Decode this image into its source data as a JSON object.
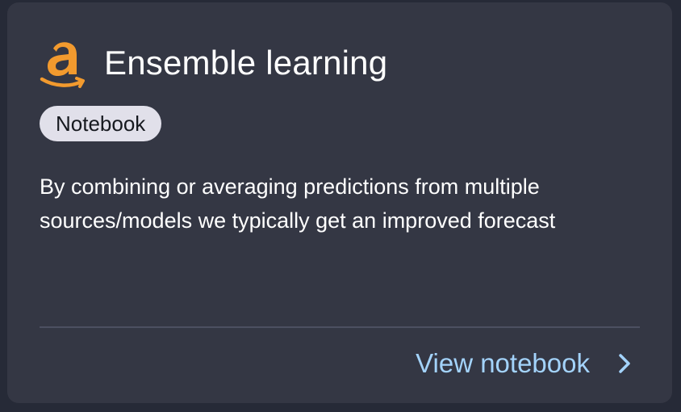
{
  "card": {
    "logo_icon": "amazon-logo-icon",
    "title": "Ensemble learning",
    "badge": "Notebook",
    "description": "By combining or averaging predictions from multiple sources/models we typically get an improved forecast",
    "link_label": "View notebook",
    "link_icon": "chevron-right-icon"
  },
  "colors": {
    "page_background": "#262a37",
    "card_background": "#343744",
    "badge_background": "#e1e0ea",
    "link": "#a3d3fb",
    "brand_orange": "#f29a2e"
  }
}
